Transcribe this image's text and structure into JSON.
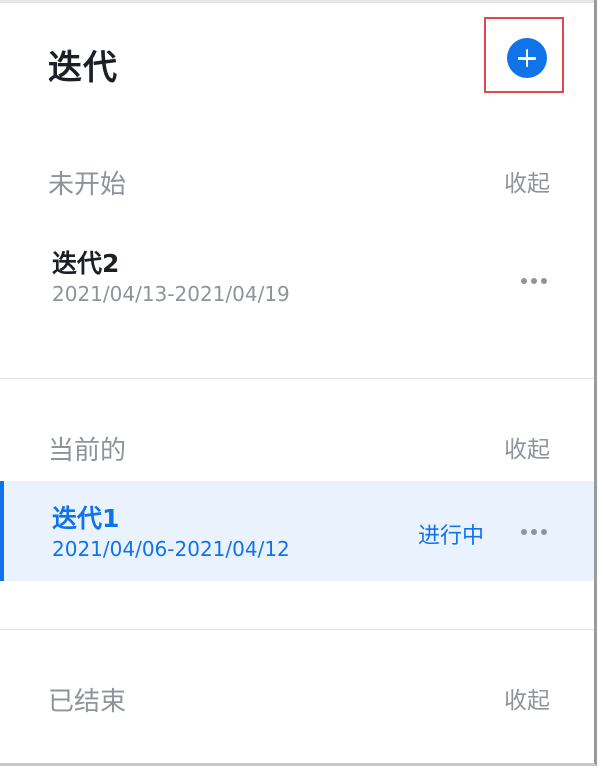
{
  "header": {
    "title": "迭代",
    "add_button_label": "+"
  },
  "sections": [
    {
      "title": "未开始",
      "collapse_label": "收起",
      "items": [
        {
          "name": "迭代2",
          "range": "2021/04/13-2021/04/19",
          "status": ""
        }
      ]
    },
    {
      "title": "当前的",
      "collapse_label": "收起",
      "items": [
        {
          "name": "迭代1",
          "range": "2021/04/06-2021/04/12",
          "status": "进行中"
        }
      ]
    },
    {
      "title": "已结束",
      "collapse_label": "收起",
      "items": []
    }
  ],
  "colors": {
    "accent": "#1173ea",
    "muted_text": "#8e939c",
    "active_row_bg": "#eaf3fd",
    "highlight_border": "#e0474c"
  },
  "icons": {
    "add": "plus-circle-icon",
    "more": "ellipsis-icon"
  }
}
